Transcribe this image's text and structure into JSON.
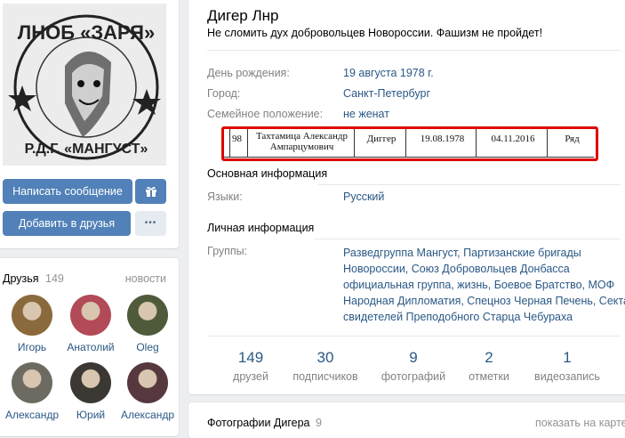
{
  "profile": {
    "name": "Дигер Лнр",
    "status": "Не сломить дух добровольцев Новороссии. Фашизм не пройдет!"
  },
  "info": {
    "birthday_label": "День рождения:",
    "birthday_value": "19 августа 1978 г.",
    "city_label": "Город:",
    "city_value": "Санкт-Петербург",
    "family_label": "Семейное положение:",
    "family_value": "не женат"
  },
  "table_snippet": {
    "num": "98",
    "name_line1": "Тахтамица Александр",
    "name_line2": "Ампарцумович",
    "alias": "Диггер",
    "date1": "19.08.1978",
    "date2": "04.11.2016",
    "rank": "Ряд"
  },
  "basic": {
    "heading": "Основная информация",
    "languages_label": "Языки:",
    "languages_value": "Русский"
  },
  "personal": {
    "heading": "Личная информация",
    "groups_label": "Группы:",
    "groups_lines": [
      "Разведгруппа Мангуст, Партизанские бригады",
      "Новороссии, Союз Добровольцев Донбасса",
      "официальная группа, жизнь, Боевое Братство, МОФ",
      "Народная Дипломатия, Спецноз Черная Печень, Секта",
      "свидетелей Преподобного Старца Чебураха"
    ]
  },
  "stats": [
    {
      "count": "149",
      "label": "друзей"
    },
    {
      "count": "30",
      "label": "подписчиков"
    },
    {
      "count": "9",
      "label": "фотографий"
    },
    {
      "count": "2",
      "label": "отметки"
    },
    {
      "count": "1",
      "label": "видеозапись"
    }
  ],
  "photos": {
    "heading": "Фотографии Дигера",
    "count": "9",
    "map_link": "показать на карте"
  },
  "actions": {
    "message": "Написать сообщение",
    "add_friend": "Добавить в друзья",
    "more": "•••"
  },
  "avatar_text": {
    "top": "ЛНОБ «ЗАРЯ»",
    "bottom": "Р.Д.Г. «МАНГУСТ»"
  },
  "friends": {
    "title": "Друзья",
    "count": "149",
    "news_link": "новости",
    "list": [
      {
        "name": "Игорь",
        "color": "#8a6a3c"
      },
      {
        "name": "Анатолий",
        "color": "#b24a58"
      },
      {
        "name": "Oleg",
        "color": "#4f5a3a"
      },
      {
        "name": "Александр",
        "color": "#6d6a61"
      },
      {
        "name": "Юрий",
        "color": "#3b3833"
      },
      {
        "name": "Александр",
        "color": "#57383e"
      }
    ]
  },
  "colors": {
    "link": "#2a5885",
    "primary_button": "#5181b8",
    "highlight_box": "#e00000"
  }
}
